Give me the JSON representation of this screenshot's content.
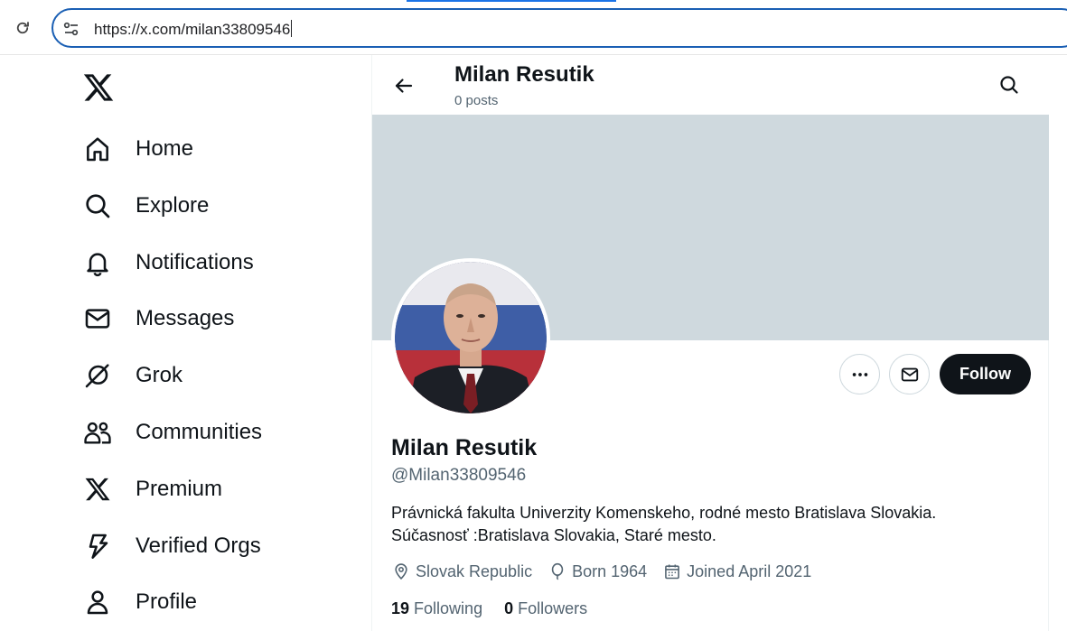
{
  "browser": {
    "url": "https://x.com/milan33809546"
  },
  "sidebar": {
    "logo": "x-logo",
    "items": [
      {
        "label": "Home",
        "icon": "home-icon"
      },
      {
        "label": "Explore",
        "icon": "search-icon"
      },
      {
        "label": "Notifications",
        "icon": "bell-icon"
      },
      {
        "label": "Messages",
        "icon": "envelope-icon"
      },
      {
        "label": "Grok",
        "icon": "grok-icon"
      },
      {
        "label": "Communities",
        "icon": "people-icon"
      },
      {
        "label": "Premium",
        "icon": "x-logo-icon"
      },
      {
        "label": "Verified Orgs",
        "icon": "lightning-icon"
      },
      {
        "label": "Profile",
        "icon": "person-icon"
      }
    ]
  },
  "header": {
    "name": "Milan Resutik",
    "posts": "0 posts"
  },
  "profile": {
    "name": "Milan Resutik",
    "handle": "@Milan33809546",
    "bio_line1": "Právnická fakulta Univerzity Komenskeho, rodné mesto Bratislava Slovakia.",
    "bio_line2": "Súčasnosť :Bratislava Slovakia, Staré mesto.",
    "location": "Slovak Republic",
    "born": "Born 1964",
    "joined": "Joined April 2021",
    "following_count": "19",
    "following_label": "Following",
    "followers_count": "0",
    "followers_label": "Followers",
    "follow_label": "Follow"
  },
  "colors": {
    "banner": "#cfd9de",
    "text_primary": "#0f1419",
    "text_secondary": "#536471",
    "follow_bg": "#0f1419",
    "url_focus": "#1a5fb4"
  }
}
